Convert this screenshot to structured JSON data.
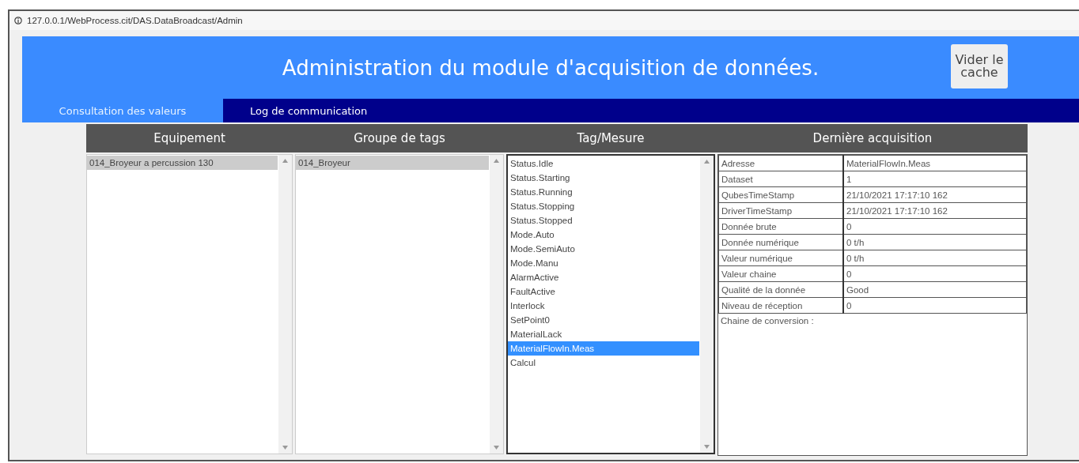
{
  "address_bar": {
    "url": "127.0.0.1/WebProcess.cit/DAS.DataBroadcast/Admin"
  },
  "header": {
    "title": "Administration du module d'acquisition de données.",
    "button": "Vider le cache"
  },
  "tabs": [
    {
      "label": "Consultation des valeurs",
      "selected": true
    },
    {
      "label": "Log de communication",
      "selected": false
    }
  ],
  "columns": [
    "Equipement",
    "Groupe de tags",
    "Tag/Mesure",
    "Dernière acquisition"
  ],
  "lists": [
    {
      "focused": false,
      "items": [
        {
          "label": "014_Broyeur a percussion 130",
          "selected": true
        }
      ]
    },
    {
      "focused": false,
      "items": [
        {
          "label": "014_Broyeur",
          "selected": true
        }
      ]
    },
    {
      "focused": true,
      "items": [
        {
          "label": "Status.Idle",
          "selected": false
        },
        {
          "label": "Status.Starting",
          "selected": false
        },
        {
          "label": "Status.Running",
          "selected": false
        },
        {
          "label": "Status.Stopping",
          "selected": false
        },
        {
          "label": "Status.Stopped",
          "selected": false
        },
        {
          "label": "Mode.Auto",
          "selected": false
        },
        {
          "label": "Mode.SemiAuto",
          "selected": false
        },
        {
          "label": "Mode.Manu",
          "selected": false
        },
        {
          "label": "AlarmActive",
          "selected": false
        },
        {
          "label": "FaultActive",
          "selected": false
        },
        {
          "label": "Interlock",
          "selected": false
        },
        {
          "label": "SetPoint0",
          "selected": false
        },
        {
          "label": "MaterialLack",
          "selected": false
        },
        {
          "label": "MaterialFlowIn.Meas",
          "selected": true
        },
        {
          "label": "Calcul",
          "selected": false
        }
      ]
    }
  ],
  "details": {
    "rows": [
      {
        "label": "Adresse",
        "value": "MaterialFlowIn.Meas"
      },
      {
        "label": "Dataset",
        "value": "1"
      },
      {
        "label": "QubesTimeStamp",
        "value": "21/10/2021 17:17:10 162"
      },
      {
        "label": "DriverTimeStamp",
        "value": "21/10/2021 17:17:10 162"
      },
      {
        "label": "Donnée brute",
        "value": "0"
      },
      {
        "label": "Donnée numérique",
        "value": "0 t/h"
      },
      {
        "label": "Valeur numérique",
        "value": "0 t/h"
      },
      {
        "label": "Valeur chaine",
        "value": "0"
      },
      {
        "label": "Qualité de la donnée",
        "value": "Good"
      },
      {
        "label": "Niveau de réception",
        "value": "0"
      }
    ],
    "conversion_label": "Chaine de conversion :"
  }
}
